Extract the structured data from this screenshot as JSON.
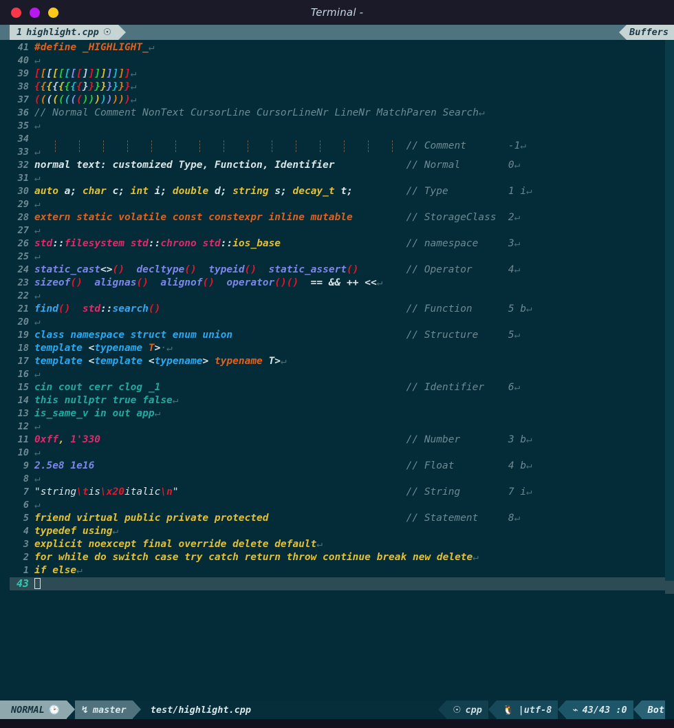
{
  "window": {
    "title": "Terminal -",
    "controls": [
      {
        "name": "close",
        "color": "#f8374a"
      },
      {
        "name": "minimize",
        "color": "#b719ee"
      },
      {
        "name": "maximize",
        "color": "#fbc91c"
      }
    ]
  },
  "tabline": {
    "tab_number": "1",
    "tab_label": "highlight.cpp",
    "tab_modified_icon": "circle-slash-icon",
    "buffers_label": "Buffers"
  },
  "editor": {
    "current_line": "43",
    "total_lines": "43",
    "column": "0",
    "lines": [
      {
        "num": "41",
        "tokens": [
          {
            "t": "#define _HIGHLIGHT_",
            "c": "c-preproc"
          },
          {
            "t": "↵",
            "c": "c-eol"
          }
        ]
      },
      {
        "num": "40",
        "tokens": [
          {
            "t": "↵",
            "c": "c-eol"
          }
        ]
      },
      {
        "num": "39",
        "tokens": [
          {
            "t": "[",
            "c": "rb1"
          },
          {
            "t": "[",
            "c": "rb2"
          },
          {
            "t": "[",
            "c": "rb3"
          },
          {
            "t": "[",
            "c": "rb4"
          },
          {
            "t": "[",
            "c": "rb5"
          },
          {
            "t": "[",
            "c": "rb6"
          },
          {
            "t": "[",
            "c": "rb7"
          },
          {
            "t": "[",
            "c": "rb1"
          },
          {
            "t": "]",
            "c": "rb3"
          },
          {
            "t": "]",
            "c": "rb1"
          },
          {
            "t": "]",
            "c": "rb5"
          },
          {
            "t": "]",
            "c": "rb4"
          },
          {
            "t": "]",
            "c": "rb7"
          },
          {
            "t": "]",
            "c": "rb6"
          },
          {
            "t": "]",
            "c": "rb2"
          },
          {
            "t": "]",
            "c": "rb1"
          },
          {
            "t": "↵",
            "c": "c-eol"
          }
        ]
      },
      {
        "num": "38",
        "tokens": [
          {
            "t": "{",
            "c": "rb1"
          },
          {
            "t": "{",
            "c": "rb2"
          },
          {
            "t": "{",
            "c": "rb4"
          },
          {
            "t": "{",
            "c": "rb3"
          },
          {
            "t": "{",
            "c": "rb4"
          },
          {
            "t": "{",
            "c": "rb5"
          },
          {
            "t": "{",
            "c": "rb6"
          },
          {
            "t": "{",
            "c": "rb1"
          },
          {
            "t": "}",
            "c": "rb3"
          },
          {
            "t": "}",
            "c": "rb1"
          },
          {
            "t": "}",
            "c": "rb5"
          },
          {
            "t": "}",
            "c": "rb4"
          },
          {
            "t": "}",
            "c": "rb7"
          },
          {
            "t": "}",
            "c": "rb6"
          },
          {
            "t": "}",
            "c": "rb2"
          },
          {
            "t": "}",
            "c": "rb1"
          },
          {
            "t": "↵",
            "c": "c-eol"
          }
        ]
      },
      {
        "num": "37",
        "tokens": [
          {
            "t": "(",
            "c": "rb1"
          },
          {
            "t": "(",
            "c": "rb2"
          },
          {
            "t": "(",
            "c": "rb3"
          },
          {
            "t": "(",
            "c": "rb4"
          },
          {
            "t": "(",
            "c": "rb5"
          },
          {
            "t": "(",
            "c": "rb6"
          },
          {
            "t": "(",
            "c": "rb7"
          },
          {
            "t": "(",
            "c": "rb1"
          },
          {
            "t": ")",
            "c": "rb5"
          },
          {
            "t": ")",
            "c": "rb5"
          },
          {
            "t": ")",
            "c": "rb4"
          },
          {
            "t": ")",
            "c": "rb6"
          },
          {
            "t": ")",
            "c": "rb7"
          },
          {
            "t": ")",
            "c": "rb2"
          },
          {
            "t": ")",
            "c": "rb2"
          },
          {
            "t": ")",
            "c": "rb1"
          },
          {
            "t": "↵",
            "c": "c-eol"
          }
        ]
      },
      {
        "num": "36",
        "tokens": [
          {
            "t": "// Normal Comment NonText CursorLine CursorLineNr LineNr MatchParen Search",
            "c": "c-comment"
          },
          {
            "t": "↵",
            "c": "c-eol"
          }
        ]
      },
      {
        "num": "35",
        "tokens": [
          {
            "t": "↵",
            "c": "c-eol"
          }
        ]
      },
      {
        "num": "34",
        "tokens": [],
        "indent_guides": 15,
        "comment": "// Comment",
        "comment_val": "-1"
      },
      {
        "num": "33",
        "tokens": [
          {
            "t": "↵",
            "c": "c-eol"
          }
        ]
      },
      {
        "num": "32",
        "tokens": [
          {
            "t": "normal text: customized Type, Function, Identifier",
            "c": "c-normal"
          }
        ],
        "comment": "// Normal",
        "comment_val": "0"
      },
      {
        "num": "31",
        "tokens": [
          {
            "t": "↵",
            "c": "c-eol"
          }
        ]
      },
      {
        "num": "30",
        "tokens": [
          {
            "t": "auto",
            "c": "c-type"
          },
          {
            "t": " ",
            "c": "c-normal"
          },
          {
            "t": "a;",
            "c": "c-normal"
          },
          {
            "t": " ",
            "c": "c-normal"
          },
          {
            "t": "char",
            "c": "c-type"
          },
          {
            "t": " ",
            "c": "c-normal"
          },
          {
            "t": "c;",
            "c": "c-normal"
          },
          {
            "t": " ",
            "c": "c-normal"
          },
          {
            "t": "int",
            "c": "c-type"
          },
          {
            "t": " ",
            "c": "c-normal"
          },
          {
            "t": "i;",
            "c": "c-normal"
          },
          {
            "t": " ",
            "c": "c-normal"
          },
          {
            "t": "double",
            "c": "c-type"
          },
          {
            "t": " ",
            "c": "c-normal"
          },
          {
            "t": "d;",
            "c": "c-normal"
          },
          {
            "t": " ",
            "c": "c-normal"
          },
          {
            "t": "string",
            "c": "c-type"
          },
          {
            "t": " ",
            "c": "c-normal"
          },
          {
            "t": "s;",
            "c": "c-normal"
          },
          {
            "t": " ",
            "c": "c-normal"
          },
          {
            "t": "decay_t",
            "c": "c-type"
          },
          {
            "t": " ",
            "c": "c-normal"
          },
          {
            "t": "t;",
            "c": "c-normal"
          }
        ],
        "comment": "// Type",
        "comment_val": "1 i"
      },
      {
        "num": "29",
        "tokens": [
          {
            "t": "↵",
            "c": "c-eol"
          }
        ]
      },
      {
        "num": "28",
        "tokens": [
          {
            "t": "extern static volatile const constexpr inline mutable",
            "c": "c-storage"
          }
        ],
        "comment": "// StorageClass",
        "comment_val": "2"
      },
      {
        "num": "27",
        "tokens": [
          {
            "t": "↵",
            "c": "c-eol"
          }
        ]
      },
      {
        "num": "26",
        "tokens": [
          {
            "t": "std",
            "c": "c-namespace"
          },
          {
            "t": "::",
            "c": "c-white"
          },
          {
            "t": "filesystem",
            "c": "c-namespace"
          },
          {
            "t": " ",
            "c": "c-normal"
          },
          {
            "t": "std",
            "c": "c-namespace"
          },
          {
            "t": "::",
            "c": "c-white"
          },
          {
            "t": "chrono",
            "c": "c-namespace"
          },
          {
            "t": " ",
            "c": "c-normal"
          },
          {
            "t": "std",
            "c": "c-namespace"
          },
          {
            "t": "::",
            "c": "c-white"
          },
          {
            "t": "ios_base",
            "c": "c-type"
          }
        ],
        "comment": "// namespace",
        "comment_val": "3"
      },
      {
        "num": "25",
        "tokens": [
          {
            "t": "↵",
            "c": "c-eol"
          }
        ]
      },
      {
        "num": "24",
        "tokens": [
          {
            "t": "static_cast",
            "c": "c-op"
          },
          {
            "t": "<>",
            "c": "c-white"
          },
          {
            "t": "()",
            "c": "c-paren-red"
          },
          {
            "t": "  ",
            "c": "c-normal"
          },
          {
            "t": "decltype",
            "c": "c-op"
          },
          {
            "t": "()",
            "c": "c-paren-red"
          },
          {
            "t": "  ",
            "c": "c-normal"
          },
          {
            "t": "typeid",
            "c": "c-op"
          },
          {
            "t": "()",
            "c": "c-paren-red"
          },
          {
            "t": "  ",
            "c": "c-normal"
          },
          {
            "t": "static_assert",
            "c": "c-op"
          },
          {
            "t": "()",
            "c": "c-paren-red"
          }
        ],
        "comment": "// Operator",
        "comment_val": "4"
      },
      {
        "num": "23",
        "tokens": [
          {
            "t": "sizeof",
            "c": "c-op"
          },
          {
            "t": "()",
            "c": "c-paren-red"
          },
          {
            "t": "  ",
            "c": "c-normal"
          },
          {
            "t": "alignas",
            "c": "c-op"
          },
          {
            "t": "()",
            "c": "c-paren-red"
          },
          {
            "t": "  ",
            "c": "c-normal"
          },
          {
            "t": "alignof",
            "c": "c-op"
          },
          {
            "t": "()",
            "c": "c-paren-red"
          },
          {
            "t": "  ",
            "c": "c-normal"
          },
          {
            "t": "operator",
            "c": "c-op"
          },
          {
            "t": "()()",
            "c": "c-paren-red"
          },
          {
            "t": "  ",
            "c": "c-normal"
          },
          {
            "t": "== && ++ <<",
            "c": "c-white"
          },
          {
            "t": "↵",
            "c": "c-eol"
          }
        ]
      },
      {
        "num": "22",
        "tokens": [
          {
            "t": "↵",
            "c": "c-eol"
          }
        ]
      },
      {
        "num": "21",
        "tokens": [
          {
            "t": "find",
            "c": "c-func"
          },
          {
            "t": "()",
            "c": "c-paren-red"
          },
          {
            "t": "  ",
            "c": "c-normal"
          },
          {
            "t": "std",
            "c": "c-namespace"
          },
          {
            "t": "::",
            "c": "c-white"
          },
          {
            "t": "search",
            "c": "c-func"
          },
          {
            "t": "()",
            "c": "c-paren-red"
          }
        ],
        "comment": "// Function",
        "comment_val": "5 b"
      },
      {
        "num": "20",
        "tokens": [
          {
            "t": "↵",
            "c": "c-eol"
          }
        ]
      },
      {
        "num": "19",
        "tokens": [
          {
            "t": "class namespace struct enum union",
            "c": "c-struct"
          }
        ],
        "comment": "// Structure",
        "comment_val": "5"
      },
      {
        "num": "18",
        "tokens": [
          {
            "t": "template",
            "c": "c-struct"
          },
          {
            "t": " ",
            "c": "c-normal"
          },
          {
            "t": "<",
            "c": "c-white"
          },
          {
            "t": "typename",
            "c": "c-struct"
          },
          {
            "t": " ",
            "c": "c-normal"
          },
          {
            "t": "T",
            "c": "c-template"
          },
          {
            "t": ">",
            "c": "c-white"
          },
          {
            "t": "·",
            "c": "c-eol"
          },
          {
            "t": "↵",
            "c": "c-eol"
          }
        ]
      },
      {
        "num": "17",
        "tokens": [
          {
            "t": "template",
            "c": "c-struct"
          },
          {
            "t": " ",
            "c": "c-normal"
          },
          {
            "t": "<",
            "c": "c-white"
          },
          {
            "t": "template",
            "c": "c-struct"
          },
          {
            "t": " ",
            "c": "c-normal"
          },
          {
            "t": "<",
            "c": "c-white"
          },
          {
            "t": "typename",
            "c": "c-struct"
          },
          {
            "t": ">",
            "c": "c-white"
          },
          {
            "t": " ",
            "c": "c-normal"
          },
          {
            "t": "typename",
            "c": "c-template"
          },
          {
            "t": " ",
            "c": "c-normal"
          },
          {
            "t": "T",
            "c": "c-white"
          },
          {
            "t": ">",
            "c": "c-white"
          },
          {
            "t": "↵",
            "c": "c-eol"
          }
        ]
      },
      {
        "num": "16",
        "tokens": [
          {
            "t": "↵",
            "c": "c-eol"
          }
        ]
      },
      {
        "num": "15",
        "tokens": [
          {
            "t": "cin cout cerr clog _1",
            "c": "c-ident"
          }
        ],
        "comment": "// Identifier",
        "comment_val": "6"
      },
      {
        "num": "14",
        "tokens": [
          {
            "t": "this nullptr true false",
            "c": "c-ident"
          },
          {
            "t": "↵",
            "c": "c-eol"
          }
        ]
      },
      {
        "num": "13",
        "tokens": [
          {
            "t": "is_same_v in out app",
            "c": "c-ident"
          },
          {
            "t": "↵",
            "c": "c-eol"
          }
        ]
      },
      {
        "num": "12",
        "tokens": [
          {
            "t": "↵",
            "c": "c-eol"
          }
        ]
      },
      {
        "num": "11",
        "tokens": [
          {
            "t": "0xff",
            "c": "c-number"
          },
          {
            "t": ",",
            "c": "c-type"
          },
          {
            "t": " ",
            "c": "c-normal"
          },
          {
            "t": "1'330",
            "c": "c-number"
          }
        ],
        "comment": "// Number",
        "comment_val": "3 b"
      },
      {
        "num": "10",
        "tokens": [
          {
            "t": "↵",
            "c": "c-eol"
          }
        ]
      },
      {
        "num": "9",
        "tokens": [
          {
            "t": "2.5e8 1e16",
            "c": "c-float"
          }
        ],
        "comment": "// Float",
        "comment_val": "4 b"
      },
      {
        "num": "8",
        "tokens": [
          {
            "t": "↵",
            "c": "c-eol"
          }
        ]
      },
      {
        "num": "7",
        "tokens": [
          {
            "t": "\"string",
            "c": "c-string"
          },
          {
            "t": "\\t",
            "c": "c-escape"
          },
          {
            "t": "is",
            "c": "c-string"
          },
          {
            "t": "\\x20",
            "c": "c-escape"
          },
          {
            "t": "italic",
            "c": "c-string"
          },
          {
            "t": "\\n",
            "c": "c-escape"
          },
          {
            "t": "\"",
            "c": "c-string"
          }
        ],
        "comment": "// String",
        "comment_val": "7 i"
      },
      {
        "num": "6",
        "tokens": [
          {
            "t": "↵",
            "c": "c-eol"
          }
        ]
      },
      {
        "num": "5",
        "tokens": [
          {
            "t": "friend virtual public private protected",
            "c": "c-statement"
          }
        ],
        "comment": "// Statement",
        "comment_val": "8"
      },
      {
        "num": "4",
        "tokens": [
          {
            "t": "typedef using",
            "c": "c-statement"
          },
          {
            "t": "↵",
            "c": "c-eol"
          }
        ]
      },
      {
        "num": "3",
        "tokens": [
          {
            "t": "explicit noexcept final override delete default",
            "c": "c-statement"
          },
          {
            "t": "↵",
            "c": "c-eol"
          }
        ]
      },
      {
        "num": "2",
        "tokens": [
          {
            "t": "for while do switch case try catch return throw continue break new delete",
            "c": "c-statement"
          },
          {
            "t": "↵",
            "c": "c-eol"
          }
        ]
      },
      {
        "num": "1",
        "tokens": [
          {
            "t": "if else",
            "c": "c-statement"
          },
          {
            "t": "↵",
            "c": "c-eol"
          }
        ]
      },
      {
        "num": "43",
        "tokens": [],
        "cursorline": true
      }
    ]
  },
  "statusline": {
    "mode": "NORMAL",
    "mode_icon": "clock-icon",
    "branch_icon": "git-branch-icon",
    "branch": "master",
    "file": "test/highlight.cpp",
    "filetype_icon": "circle-slash-icon",
    "filetype": "cpp",
    "os_icon": "linux-penguin-icon",
    "encoding": "|utf-8",
    "position_icon": "cursor-icon",
    "position": "43/43 :0",
    "scroll": "Bot"
  }
}
